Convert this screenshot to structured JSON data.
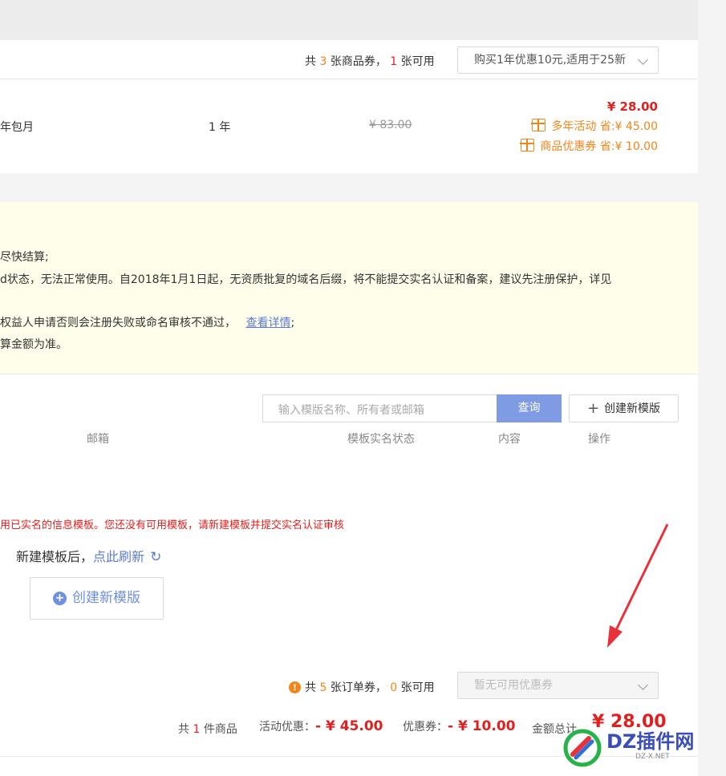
{
  "coupon_bar": {
    "prefix": "共",
    "count": "3",
    "mid": "张商品券，",
    "usable": "1",
    "suffix": "张可用",
    "selected": "购买1年优惠10元,适用于25新"
  },
  "product": {
    "name": "年包月",
    "period": "1 年",
    "original_price": "¥ 83.00",
    "price": "¥ 28.00",
    "discount_activity": "多年活动 省:¥ 45.00",
    "discount_coupon": "商品优惠券 省:¥ 10.00"
  },
  "notice": {
    "line1": "尽快结算;",
    "line2": "d状态，无法正常使用。自2018年1月1日起，无资质批复的域名后缀，将不能提交实名认证和备案，建议先注册保护，详见",
    "line3": "权益人申请否则会注册失败或命名审核不通过，",
    "line3_link": "查看详情",
    "line3_end": ";",
    "line4": "算金额为准。"
  },
  "template": {
    "search_placeholder": "输入模版名称、所有者或邮箱",
    "search_button": "查询",
    "create_button": "创建新模版",
    "columns": [
      "邮箱",
      "模板实名状态",
      "内容",
      "操作"
    ],
    "warning": "用已实名的信息模板。您还没有可用模板，请新建模板并提交实名认证审核",
    "refresh_prefix": "新建模板后，",
    "refresh_link": "点此刷新",
    "create_big_button": "创建新模版"
  },
  "order_coupon": {
    "prefix": "共",
    "count": "5",
    "mid": "张订单券，",
    "usable": "0",
    "suffix": "张可用",
    "select_placeholder": "暂无可用优惠券"
  },
  "summary": {
    "items_prefix": "共",
    "items_count": "1",
    "items_suffix": "件商品",
    "activity_label": "活动优惠：",
    "activity_value": "- ¥ 45.00",
    "coupon_label": "优惠券：",
    "coupon_value": "- ¥ 10.00",
    "total_label": "金额总计",
    "total_value": "¥ 28.00"
  },
  "watermark": {
    "brand": "DZ插件网",
    "sub": "DZ-X.NET"
  },
  "colors": {
    "accent_red": "#e0201f",
    "accent_orange": "#f08519",
    "link_blue": "#5b7bd5",
    "query_button": "#7f9be3",
    "arrow_red": "#e8323b"
  }
}
